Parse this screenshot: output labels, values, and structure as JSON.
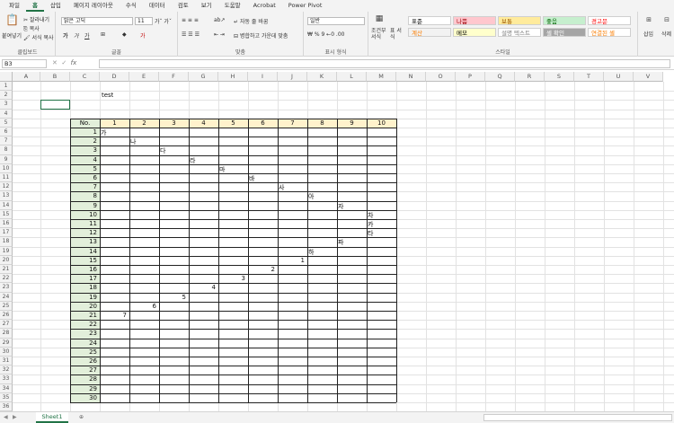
{
  "tabs": [
    "파일",
    "홈",
    "삽입",
    "페이지 레이아웃",
    "수식",
    "데이터",
    "검토",
    "보기",
    "도움말",
    "Acrobat",
    "Power Pivot"
  ],
  "active_tab": "홈",
  "ribbon": {
    "clipboard": {
      "paste": "붙여넣기",
      "cut": "잘라내기",
      "copy": "복사",
      "format_painter": "서식 복사",
      "label": "클립보드"
    },
    "font": {
      "name": "맑은 고딕",
      "size": "11",
      "label": "글꼴"
    },
    "alignment": {
      "wrap": "자동 줄 바꿈",
      "merge": "병합하고 가운데 맞춤",
      "label": "맞춤"
    },
    "number": {
      "format": "일반",
      "label": "표시 형식"
    },
    "styles": {
      "conditional": "조건부 서식",
      "table": "표 서식",
      "label": "스타일",
      "cells": [
        {
          "text": "표준",
          "bg": "#ffffff",
          "fg": "#000000"
        },
        {
          "text": "나쁨",
          "bg": "#ffc7ce",
          "fg": "#9c0006"
        },
        {
          "text": "보통",
          "bg": "#ffeb9c",
          "fg": "#9c5700"
        },
        {
          "text": "좋음",
          "bg": "#c6efce",
          "fg": "#006100"
        },
        {
          "text": "경고문",
          "bg": "#ffffff",
          "fg": "#ff0000"
        },
        {
          "text": "계산",
          "bg": "#f2f2f2",
          "fg": "#fa7d00"
        },
        {
          "text": "메모",
          "bg": "#ffffcc",
          "fg": "#000000"
        },
        {
          "text": "설명 텍스트",
          "bg": "#ffffff",
          "fg": "#7f7f7f"
        },
        {
          "text": "셀 확인",
          "bg": "#a5a5a5",
          "fg": "#ffffff"
        },
        {
          "text": "연결된 셀",
          "bg": "#ffffff",
          "fg": "#fa7d00"
        }
      ]
    },
    "cells": {
      "insert": "삽입",
      "delete": "삭제"
    }
  },
  "formula_bar": {
    "name_box": "B3",
    "fx": "fx",
    "value": ""
  },
  "columns": [
    "A",
    "B",
    "C",
    "D",
    "E",
    "F",
    "G",
    "H",
    "I",
    "J",
    "K",
    "L",
    "M",
    "N",
    "O",
    "P",
    "Q",
    "R",
    "S",
    "T",
    "U",
    "V"
  ],
  "rows": [
    1,
    2,
    3,
    4,
    5,
    6,
    7,
    8,
    9,
    10,
    11,
    12,
    13,
    14,
    15,
    16,
    17,
    18,
    19,
    20,
    21,
    22,
    23,
    24,
    25,
    26,
    27,
    28,
    29,
    30,
    31,
    32,
    33,
    34,
    35,
    36
  ],
  "cells": {
    "D2": "test"
  },
  "table": {
    "header_label": "No.",
    "header_cols": [
      "1",
      "2",
      "3",
      "4",
      "5",
      "6",
      "7",
      "8",
      "9",
      "10"
    ],
    "row_numbers": [
      "1",
      "2",
      "3",
      "4",
      "5",
      "6",
      "7",
      "8",
      "9",
      "10",
      "11",
      "12",
      "13",
      "14",
      "15",
      "16",
      "17",
      "18",
      "19",
      "20",
      "21",
      "22",
      "23",
      "24",
      "25",
      "26",
      "27",
      "28",
      "29",
      "30"
    ],
    "entries": [
      {
        "r": 1,
        "c": 1,
        "v": "가"
      },
      {
        "r": 2,
        "c": 2,
        "v": "나"
      },
      {
        "r": 3,
        "c": 3,
        "v": "다"
      },
      {
        "r": 4,
        "c": 4,
        "v": "라"
      },
      {
        "r": 5,
        "c": 5,
        "v": "마"
      },
      {
        "r": 6,
        "c": 6,
        "v": "바"
      },
      {
        "r": 7,
        "c": 7,
        "v": "사"
      },
      {
        "r": 8,
        "c": 8,
        "v": "아"
      },
      {
        "r": 9,
        "c": 9,
        "v": "자"
      },
      {
        "r": 10,
        "c": 10,
        "v": "차"
      },
      {
        "r": 11,
        "c": 10,
        "v": "카"
      },
      {
        "r": 12,
        "c": 10,
        "v": "타"
      },
      {
        "r": 13,
        "c": 9,
        "v": "파"
      },
      {
        "r": 14,
        "c": 8,
        "v": "하"
      },
      {
        "r": 15,
        "c": 7,
        "v": "1",
        "num": true
      },
      {
        "r": 16,
        "c": 6,
        "v": "2",
        "num": true
      },
      {
        "r": 17,
        "c": 5,
        "v": "3",
        "num": true
      },
      {
        "r": 18,
        "c": 4,
        "v": "4",
        "num": true
      },
      {
        "r": 19,
        "c": 3,
        "v": "5",
        "num": true
      },
      {
        "r": 20,
        "c": 2,
        "v": "6",
        "num": true
      },
      {
        "r": 21,
        "c": 1,
        "v": "7",
        "num": true
      }
    ]
  },
  "sheet_tab": "Sheet1"
}
